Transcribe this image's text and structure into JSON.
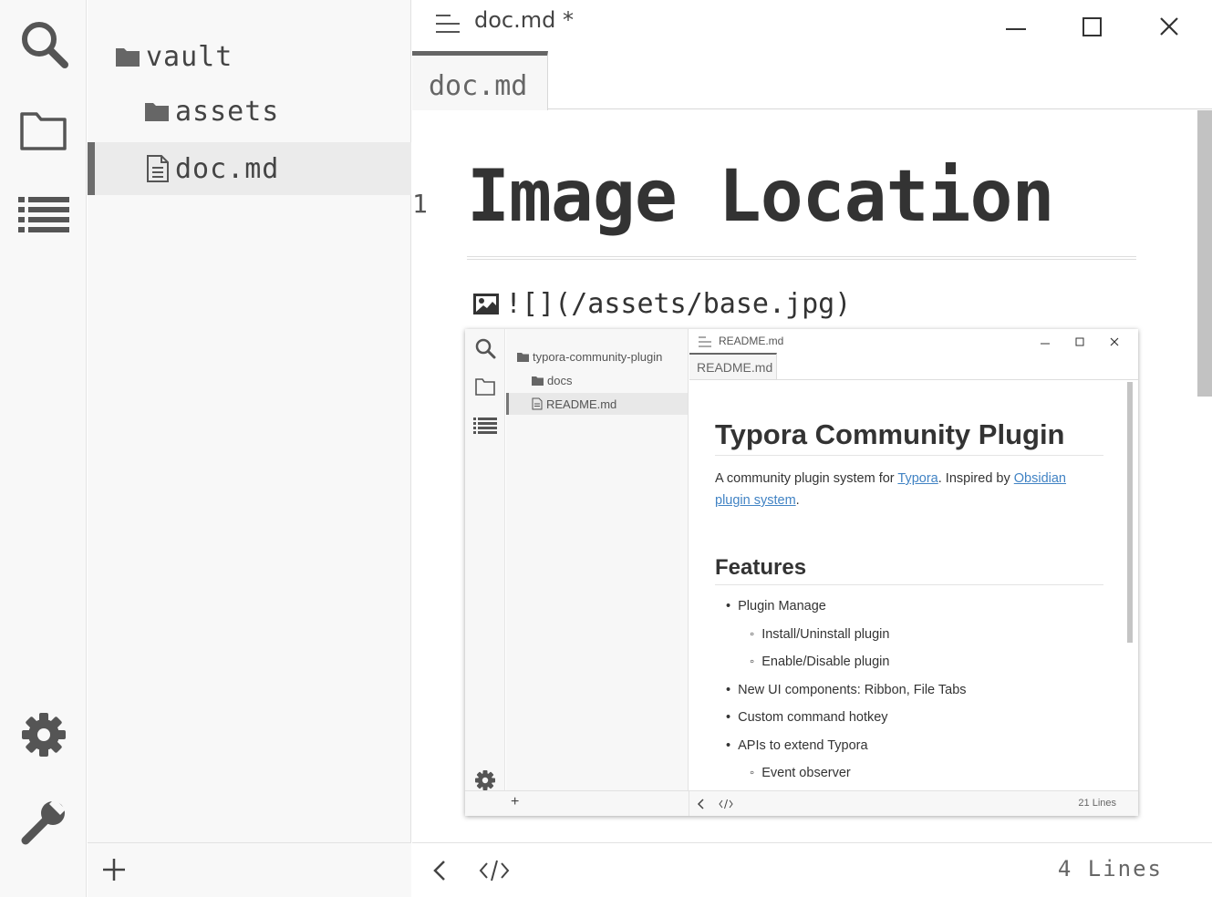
{
  "window": {
    "menu_icon": "menu-lines-icon",
    "title": "doc.md",
    "modified_marker": "*"
  },
  "ribbon": {
    "top": [
      "search-icon",
      "folder-icon",
      "outline-list-icon"
    ],
    "bottom": [
      "gear-icon",
      "wrench-icon"
    ]
  },
  "sidebar": {
    "items": [
      {
        "label": "vault",
        "icon": "folder-icon"
      },
      {
        "label": "assets",
        "icon": "folder-icon"
      },
      {
        "label": "doc.md",
        "icon": "document-icon",
        "active": true
      }
    ],
    "add_icon": "plus-icon"
  },
  "tabs": [
    {
      "label": "doc.md",
      "active": true
    }
  ],
  "editor": {
    "line_number": "1",
    "heading": "Image Location",
    "image_markdown": "![](/assets/base.jpg)",
    "image_icon": "image-icon"
  },
  "embedded_screenshot": {
    "title": "README.md",
    "tab": "README.md",
    "sidebar": [
      {
        "label": "typora-community-plugin",
        "icon": "folder-icon"
      },
      {
        "label": "docs",
        "icon": "folder-icon"
      },
      {
        "label": "README.md",
        "icon": "document-icon",
        "active": true
      }
    ],
    "heading": "Typora Community Plugin",
    "intro_prefix": "A community plugin system for ",
    "intro_link1": "Typora",
    "intro_mid": ". Inspired by ",
    "intro_link2": "Obsidian plugin system",
    "intro_suffix": ".",
    "features_heading": "Features",
    "features": [
      {
        "text": "Plugin Manage",
        "level": 0
      },
      {
        "text": "Install/Uninstall plugin",
        "level": 1
      },
      {
        "text": "Enable/Disable plugin",
        "level": 1
      },
      {
        "text": "New UI components: Ribbon, File Tabs",
        "level": 0
      },
      {
        "text": "Custom command hotkey",
        "level": 0
      },
      {
        "text": "APIs to extend Typora",
        "level": 0
      },
      {
        "text": "Event observer",
        "level": 1
      }
    ],
    "footer_plus": "+",
    "footer_lines": "21 Lines"
  },
  "statusbar": {
    "back_icon": "chevron-left-icon",
    "source_icon": "code-icon",
    "lines": "4 Lines"
  },
  "colors": {
    "icon": "#555555",
    "link": "#4183c4",
    "active_border": "#6c6c6c"
  }
}
